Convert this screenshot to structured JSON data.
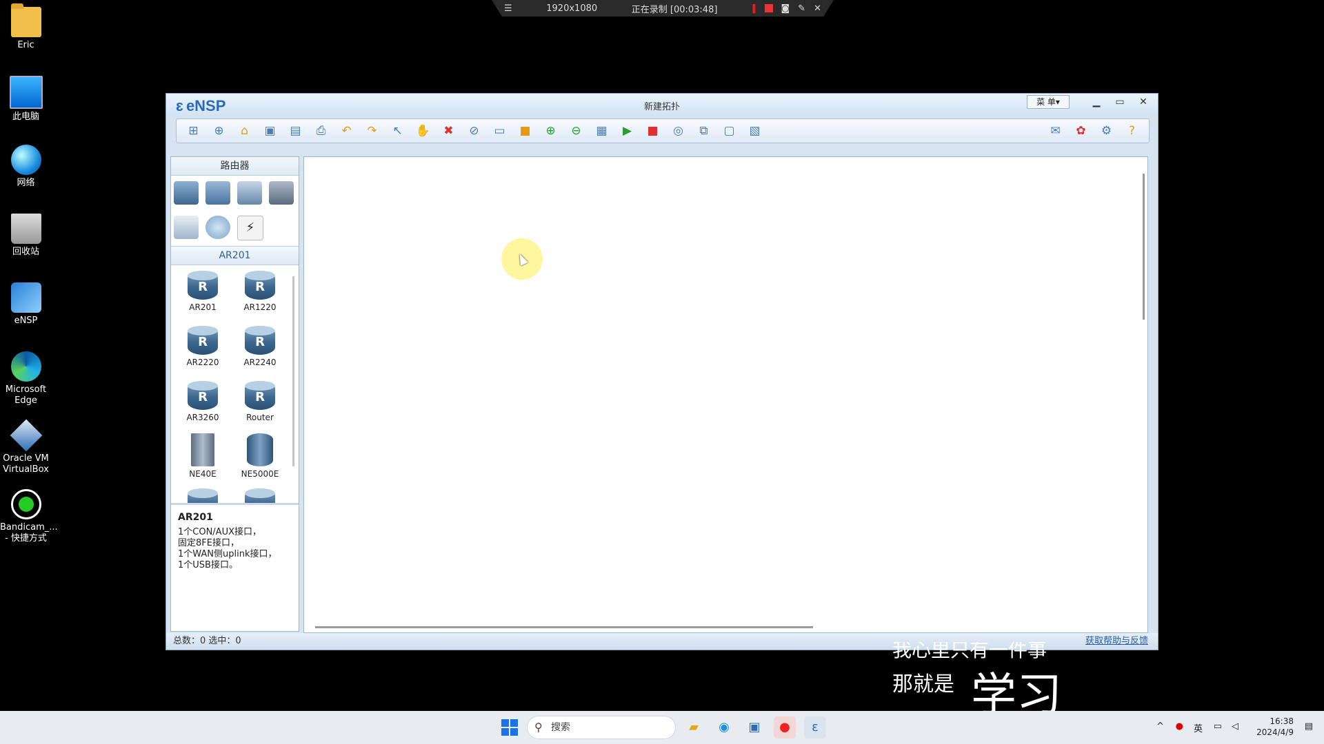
{
  "desktop": {
    "icons": [
      {
        "label": "Eric"
      },
      {
        "label": "此电脑"
      },
      {
        "label": "网络"
      },
      {
        "label": "回收站"
      },
      {
        "label": "eNSP"
      },
      {
        "label": "Microsoft Edge"
      },
      {
        "label": "Oracle VM VirtualBox"
      },
      {
        "label": "Bandicam_... - 快捷方式"
      }
    ]
  },
  "recorder": {
    "resolution": "1920x1080",
    "status": "正在录制 [00:03:48]"
  },
  "window": {
    "app_name": "eNSP",
    "title": "新建拓扑",
    "menu_label": "菜 单▾",
    "toolbar_icons": [
      "new-topology-icon",
      "new-lab-icon",
      "open-icon",
      "save-icon",
      "save-as-icon",
      "print-icon",
      "undo-icon",
      "redo-icon",
      "select-icon",
      "pan-icon",
      "delete-icon",
      "delete-link-icon",
      "text-icon",
      "rectangle-icon",
      "zoom-in-icon",
      "zoom-out-icon",
      "reset-zoom-icon",
      "start-device-icon",
      "stop-device-icon",
      "capture-icon",
      "topology-icon",
      "panel-icon",
      "screenshot-icon"
    ],
    "toolbar_right_icons": [
      "message-icon",
      "huawei-icon",
      "settings-icon",
      "help-icon"
    ]
  },
  "left_panel": {
    "category_header": "路由器",
    "subcategory": "AR201",
    "devices": [
      {
        "name": "AR201"
      },
      {
        "name": "AR1220"
      },
      {
        "name": "AR2220"
      },
      {
        "name": "AR2240"
      },
      {
        "name": "AR3260"
      },
      {
        "name": "Router"
      },
      {
        "name": "NE40E"
      },
      {
        "name": "NE5000E"
      }
    ],
    "description": {
      "title": "AR201",
      "lines": [
        "1个CON/AUX接口，",
        "固定8FE接口，",
        "1个WAN侧uplink接口，",
        "1个USB接口。"
      ]
    }
  },
  "status_bar": {
    "counts": "总数：0 选中：0",
    "help_link": "获取帮助与反馈"
  },
  "subtitles": {
    "line1": "我心里只有一件事",
    "line2": "那就是",
    "big": "学习"
  },
  "taskbar": {
    "search_placeholder": "搜索",
    "ime": "英",
    "time": "16:38",
    "date": "2024/4/9"
  }
}
